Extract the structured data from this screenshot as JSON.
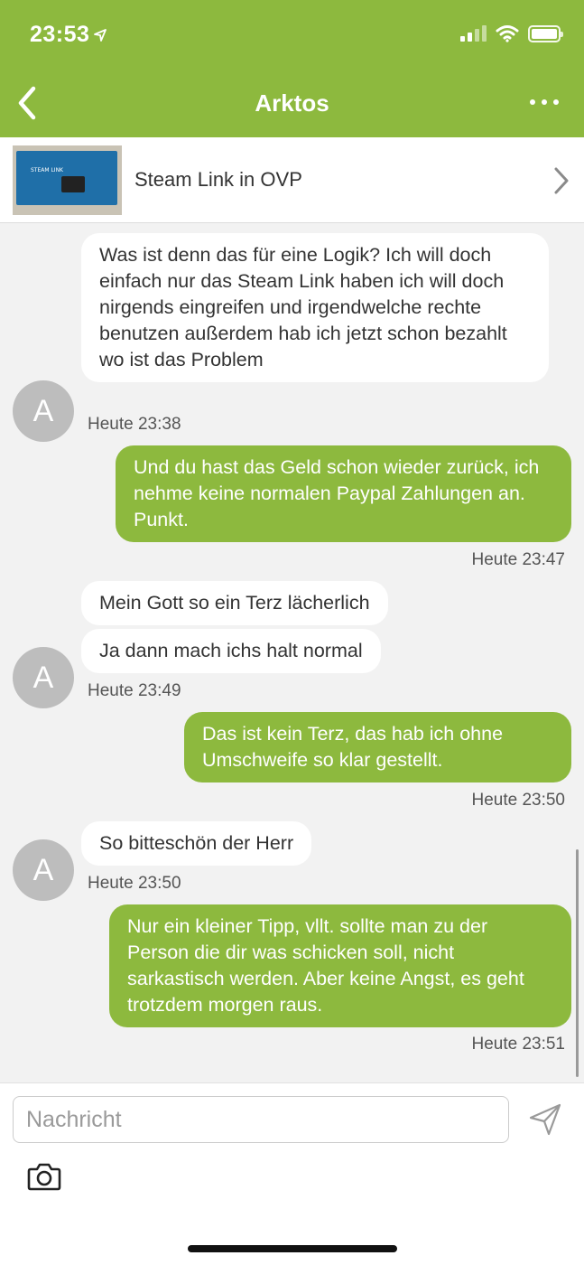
{
  "status_bar": {
    "time": "23:53"
  },
  "nav": {
    "title": "Arktos"
  },
  "listing": {
    "title": "Steam Link in OVP",
    "thumbnail_label": "STEAM LINK"
  },
  "messages": [
    {
      "dir": "in",
      "text": "Was ist denn das für eine Logik? Ich will doch einfach nur das Steam Link haben ich will doch nirgends eingreifen und irgendwelche rechte benutzen außerdem hab ich jetzt schon bezahlt wo ist das Problem"
    },
    {
      "dir": "out",
      "text": "Und du hast das Geld schon wieder zurück, ich nehme keine normalen Paypal Zahlungen an. Punkt."
    },
    {
      "dir": "in",
      "text": "Mein Gott so ein Terz lächerlich"
    },
    {
      "dir": "in",
      "text": "Ja dann mach ichs halt normal"
    },
    {
      "dir": "out",
      "text": "Das ist kein Terz, das hab ich ohne Umschweife so klar gestellt."
    },
    {
      "dir": "in",
      "text": "So bitteschön der Herr"
    },
    {
      "dir": "out",
      "text": "Nur ein kleiner Tipp, vllt. sollte man zu der Person die dir was schicken soll, nicht sarkastisch werden. Aber keine Angst, es geht trotzdem morgen raus."
    }
  ],
  "timestamps": [
    "Heute 23:38",
    "Heute 23:47",
    "Heute 23:49",
    "Heute 23:50",
    "Heute 23:50",
    "Heute 23:51"
  ],
  "avatar": {
    "initial": "A"
  },
  "composer": {
    "placeholder": "Nachricht"
  },
  "colors": {
    "accent": "#8db93e",
    "background": "#f2f2f2",
    "bubble_in": "#ffffff"
  },
  "icons": [
    "back-chevron-icon",
    "more-dots-icon",
    "chevron-right-icon",
    "send-icon",
    "camera-icon",
    "location-arrow-icon",
    "wifi-icon",
    "signal-icon",
    "battery-icon"
  ]
}
